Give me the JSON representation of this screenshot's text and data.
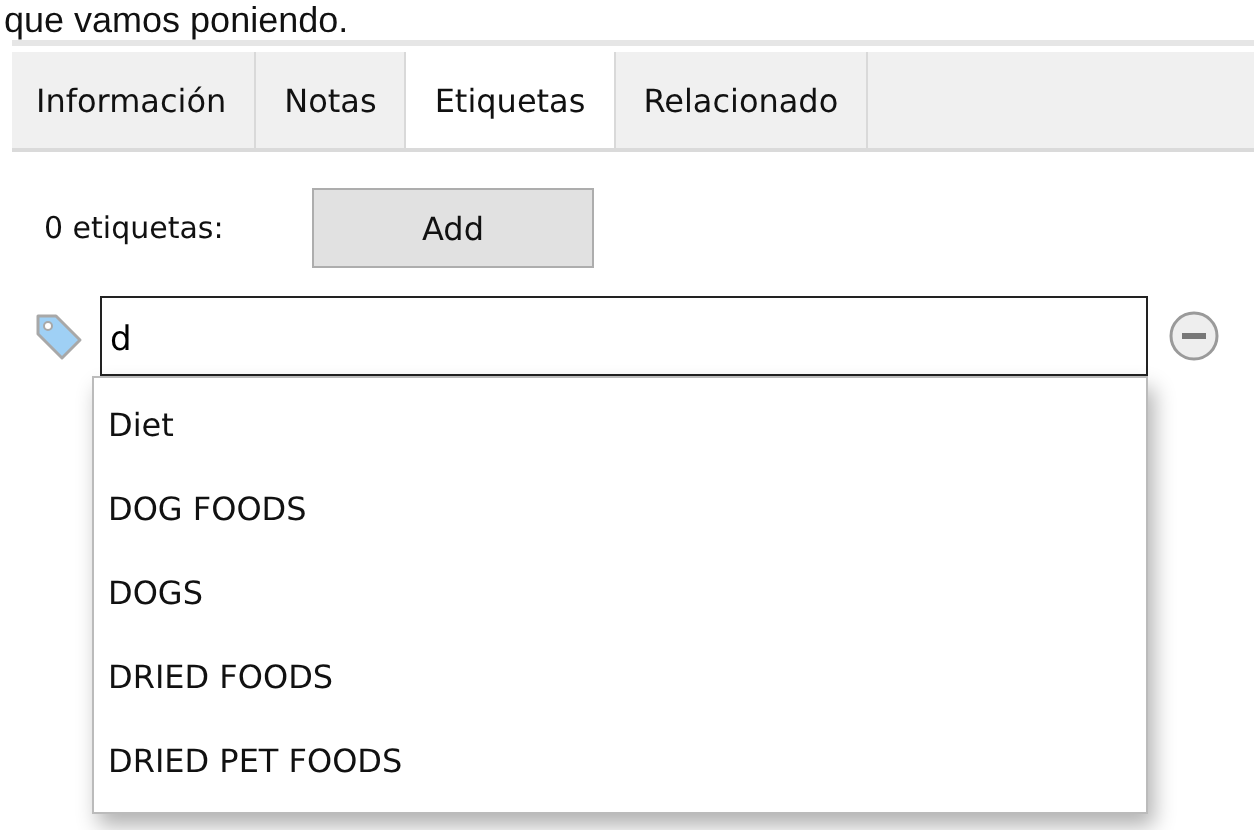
{
  "caption": "que vamos poniendo.",
  "tabs": [
    {
      "label": "Información",
      "selected": false
    },
    {
      "label": "Notas",
      "selected": false
    },
    {
      "label": "Etiquetas",
      "selected": true
    },
    {
      "label": "Relacionado",
      "selected": false
    }
  ],
  "tag_count": "0 etiquetas:",
  "add_button": "Add",
  "tag_field": {
    "value": "d"
  },
  "suggestions": [
    "Diet",
    "DOG FOODS",
    "DOGS",
    "DRIED FOODS",
    "DRIED PET FOODS"
  ]
}
